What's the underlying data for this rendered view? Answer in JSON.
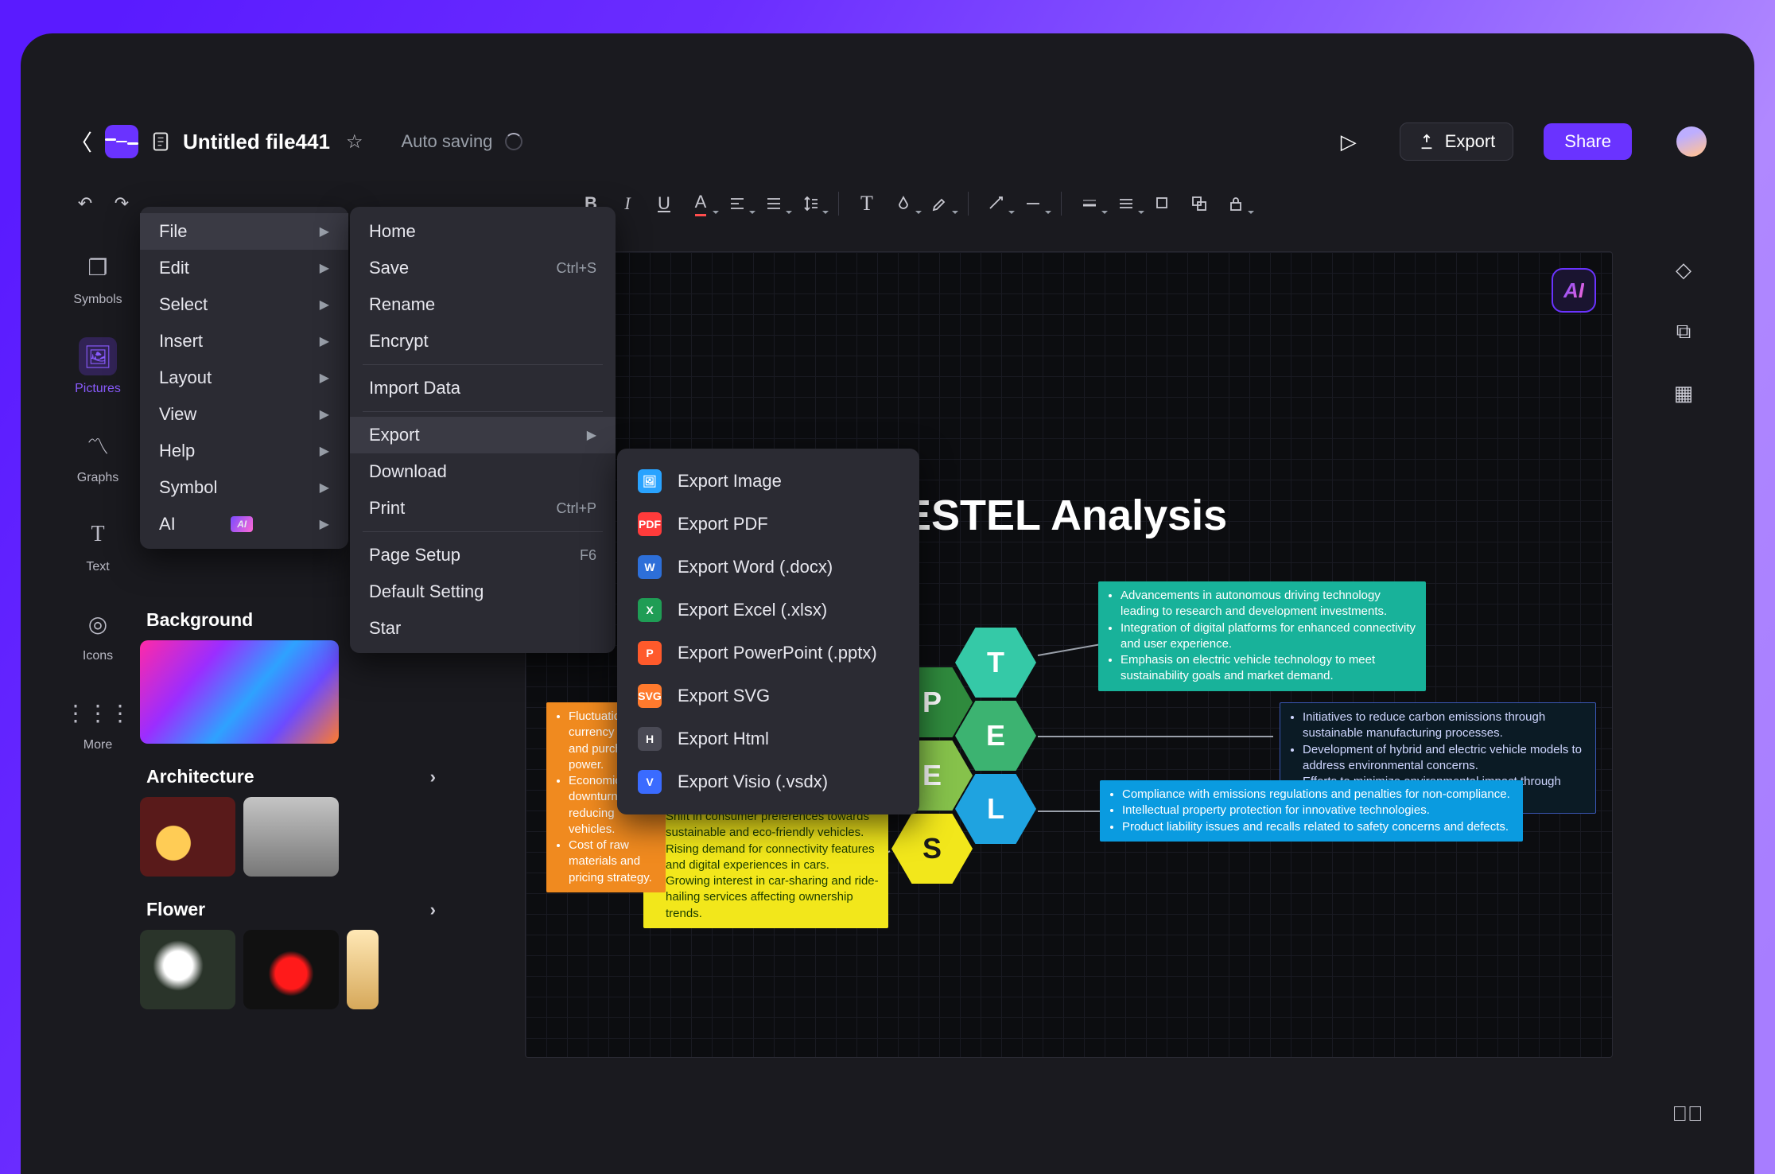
{
  "header": {
    "title": "Untitled file441",
    "autosave": "Auto saving",
    "export": "Export",
    "share": "Share"
  },
  "left_rail": {
    "symbols": "Symbols",
    "pictures": "Pictures",
    "graphs": "Graphs",
    "text": "Text",
    "icons": "Icons",
    "more": "More"
  },
  "image_panel": {
    "background": "Background",
    "architecture": "Architecture",
    "flower": "Flower"
  },
  "menus": {
    "main": [
      {
        "label": "File",
        "arrow": true,
        "hover": true
      },
      {
        "label": "Edit",
        "arrow": true
      },
      {
        "label": "Select",
        "arrow": true
      },
      {
        "label": "Insert",
        "arrow": true
      },
      {
        "label": "Layout",
        "arrow": true
      },
      {
        "label": "View",
        "arrow": true
      },
      {
        "label": "Help",
        "arrow": true
      },
      {
        "label": "Symbol",
        "arrow": true
      },
      {
        "label": "AI",
        "arrow": true,
        "ai": true
      }
    ],
    "file": [
      {
        "label": "Home"
      },
      {
        "label": "Save",
        "shortcut": "Ctrl+S"
      },
      {
        "label": "Rename"
      },
      {
        "label": "Encrypt"
      },
      {
        "label": "Import Data"
      },
      {
        "label": "Export",
        "arrow": true,
        "hover": true
      },
      {
        "label": "Download"
      },
      {
        "label": "Print",
        "shortcut": "Ctrl+P"
      },
      {
        "label": "Page Setup",
        "shortcut": "F6"
      },
      {
        "label": "Default Setting"
      },
      {
        "label": "Star"
      }
    ],
    "export": [
      {
        "label": "Export Image",
        "icon": "img"
      },
      {
        "label": "Export PDF",
        "icon": "pdf"
      },
      {
        "label": "Export Word (.docx)",
        "icon": "word"
      },
      {
        "label": "Export Excel (.xlsx)",
        "icon": "xls"
      },
      {
        "label": "Export PowerPoint (.pptx)",
        "icon": "ppt"
      },
      {
        "label": "Export SVG",
        "icon": "svg"
      },
      {
        "label": "Export Html",
        "icon": "html"
      },
      {
        "label": "Export Visio (.vsdx)",
        "icon": "vsd"
      }
    ]
  },
  "canvas": {
    "title": "PESTEL Analysis",
    "hex": {
      "p": "P",
      "e1": "E",
      "s": "S",
      "t": "T",
      "e2": "E",
      "l": "L"
    },
    "tech": [
      "Advancements in autonomous driving technology leading to research and development investments.",
      "Integration of digital platforms for enhanced connectivity and user experience.",
      "Emphasis on electric vehicle technology to meet sustainability goals and market demand."
    ],
    "env": [
      "Initiatives to reduce carbon emissions through sustainable manufacturing processes.",
      "Development of hybrid and electric vehicle models to address environmental concerns.",
      "Efforts to minimize environmental impact through recycling and waste reduction programs."
    ],
    "leg": [
      "Compliance with emissions regulations and penalties for non-compliance.",
      "Intellectual property protection for innovative technologies.",
      "Product liability issues and recalls related to safety concerns and defects."
    ],
    "soc": [
      "Shift in consumer preferences towards sustainable and eco-friendly vehicles.",
      "Rising demand for connectivity features and digital experiences in cars.",
      "Growing interest in car-sharing and ride-hailing services affecting ownership trends."
    ],
    "eco": [
      "Fluctuations in currency rates and purchasing power.",
      "Economic downturn reducing vehicles.",
      "Cost of raw materials and pricing strategy."
    ]
  },
  "export_icon_text": {
    "img": "🖼",
    "pdf": "PDF",
    "word": "W",
    "xls": "X",
    "ppt": "P",
    "svg": "SVG",
    "html": "H",
    "vsd": "V"
  }
}
